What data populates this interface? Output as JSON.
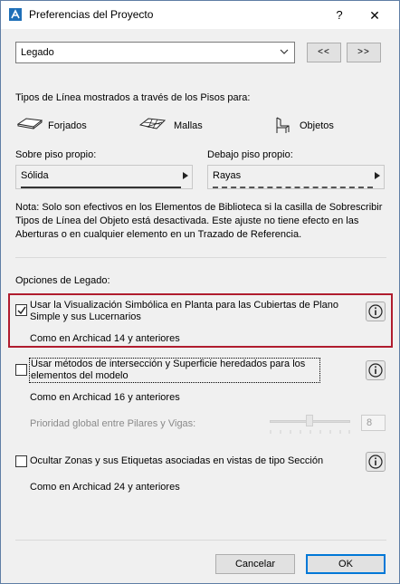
{
  "window": {
    "title": "Preferencias del Proyecto",
    "help_glyph": "?",
    "close_glyph": "✕"
  },
  "preset": {
    "value": "Legado",
    "prev_label": "<<",
    "next_label": ">>"
  },
  "linetypes": {
    "heading": "Tipos de Línea mostrados a través de los Pisos para:",
    "items": [
      {
        "label": "Forjados",
        "icon": "slab-icon"
      },
      {
        "label": "Mallas",
        "icon": "mesh-icon"
      },
      {
        "label": "Objetos",
        "icon": "object-chair-icon"
      }
    ],
    "own_floor_label": "Sobre piso propio:",
    "own_floor_value": "Sólida",
    "below_floor_label": "Debajo piso propio:",
    "below_floor_value": "Rayas",
    "note": "Nota: Solo son efectivos en los Elementos de Biblioteca si la casilla de Sobrescribir Tipos de Línea del Objeto está desactivada. Este ajuste no tiene efecto en las Aberturas o en cualquier elemento en un Trazado de Referencia."
  },
  "legacy": {
    "heading": "Opciones de Legado:",
    "options": [
      {
        "label": "Usar la Visualización Simbólica en Planta para las Cubiertas de Plano Simple y sus Lucernarios",
        "sub": "Como en Archicad 14 y anteriores",
        "checked": true
      },
      {
        "label": "Usar métodos de intersección y Superficie heredados para los elementos del modelo",
        "sub": "Como en Archicad 16 y anteriores",
        "checked": false
      },
      {
        "label": "Ocultar Zonas y sus Etiquetas asociadas en vistas de tipo Sección",
        "sub": "Como en Archicad 24 y anteriores",
        "checked": false
      }
    ],
    "priority_label": "Prioridad global entre Pilares y Vigas:",
    "priority_value": "8"
  },
  "buttons": {
    "cancel": "Cancelar",
    "ok": "OK"
  },
  "colors": {
    "highlight_border": "#b01c2e",
    "default_button_border": "#0078d7"
  }
}
